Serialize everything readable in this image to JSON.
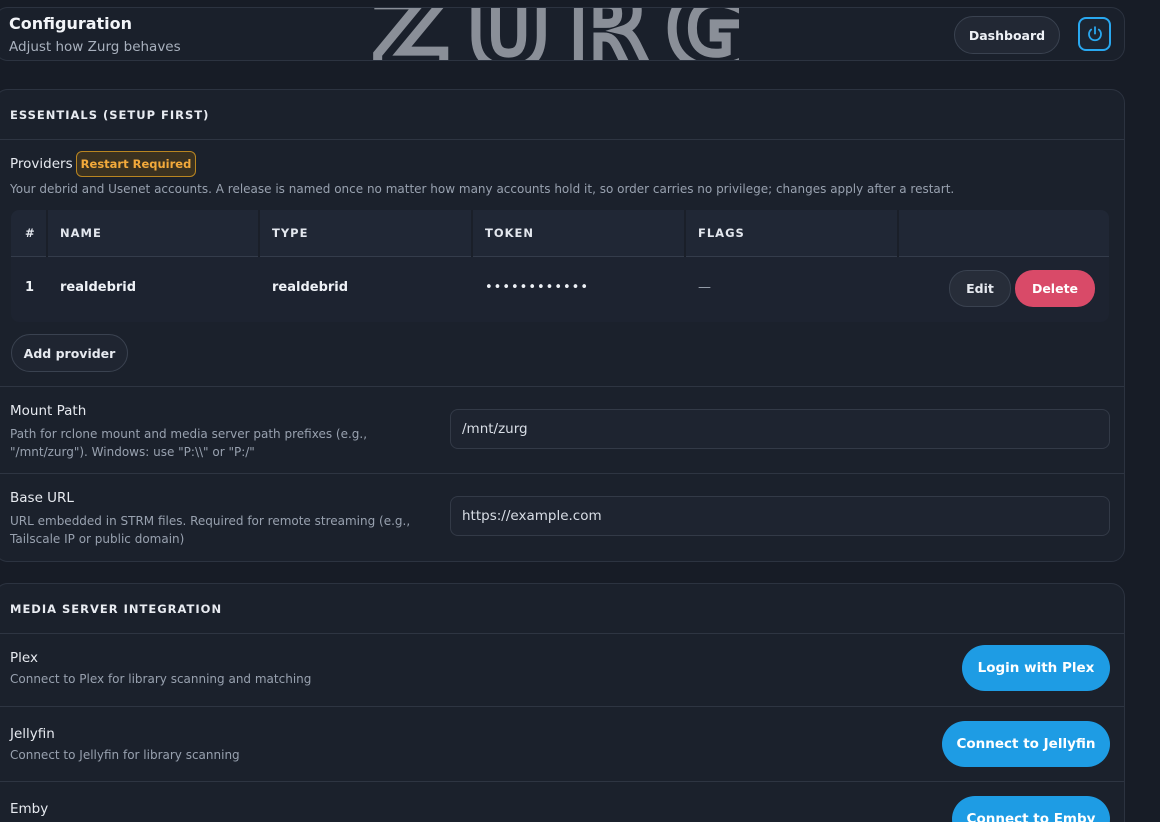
{
  "header": {
    "title": "Configuration",
    "subtitle": "Adjust how Zurg behaves",
    "logo_text": "ZURG",
    "dashboard_label": "Dashboard",
    "power_icon": "power-icon"
  },
  "essentials": {
    "heading": "ESSENTIALS (SETUP FIRST)",
    "providers": {
      "label": "Providers",
      "badge": "Restart Required",
      "description": "Your debrid and Usenet accounts. A release is named once no matter how many accounts hold it, so order carries no privilege; changes apply after a restart.",
      "columns": [
        "#",
        "NAME",
        "TYPE",
        "TOKEN",
        "FLAGS"
      ],
      "rows": [
        {
          "index": "1",
          "name": "realdebrid",
          "type": "realdebrid",
          "token": "••••••••••••",
          "flags": "—",
          "edit": "Edit",
          "delete": "Delete"
        }
      ],
      "add_label": "Add provider"
    },
    "mount_path": {
      "label": "Mount Path",
      "description": "Path for rclone mount and media server path prefixes (e.g., \"/mnt/zurg\"). Windows: use \"P:\\\\\" or \"P:/\"",
      "value": "/mnt/zurg"
    },
    "base_url": {
      "label": "Base URL",
      "description": "URL embedded in STRM files. Required for remote streaming (e.g., Tailscale IP or public domain)",
      "value": "https://example.com"
    }
  },
  "media": {
    "heading": "MEDIA SERVER INTEGRATION",
    "plex": {
      "label": "Plex",
      "description": "Connect to Plex for library scanning and matching",
      "button": "Login with Plex"
    },
    "jellyfin": {
      "label": "Jellyfin",
      "description": "Connect to Jellyfin for library scanning",
      "button": "Connect to Jellyfin"
    },
    "emby": {
      "label": "Emby",
      "button": "Connect to Emby"
    }
  },
  "colors": {
    "accent": "#1e9ce4",
    "danger": "#d94a68",
    "warning": "#f2a93b",
    "background": "#171c26"
  }
}
